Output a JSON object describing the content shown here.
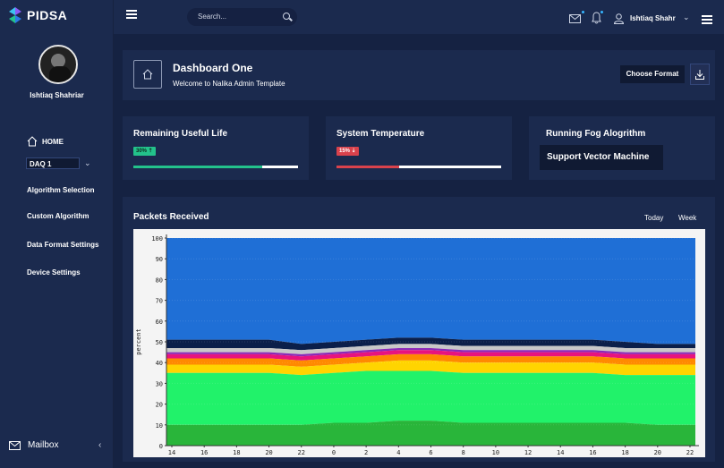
{
  "brand": {
    "name": "PIDSA"
  },
  "sidebar": {
    "username": "Ishtiaq Shahriar",
    "home_label": "HOME",
    "daq_selected": "DAQ 1",
    "items": [
      {
        "label": "Algorithm Selection"
      },
      {
        "label": "Custom Algorithm"
      },
      {
        "label": "Data Format Settings"
      },
      {
        "label": "Device Settings"
      }
    ],
    "mailbox_label": "Mailbox"
  },
  "header": {
    "search_placeholder": "Search...",
    "profile_name": "Ishtiaq Shahr"
  },
  "dashboard": {
    "title": "Dashboard One",
    "subtitle": "Welcome to Nalika Admin Template",
    "choose_format_label": "Choose Format"
  },
  "stats": [
    {
      "title": "Remaining Useful Life",
      "badge": "30% ⇡",
      "progress": 0.78,
      "color": "#23c28b"
    },
    {
      "title": "System Temperature",
      "badge": "15% ⇣",
      "progress": 0.38,
      "color": "#d9424c"
    }
  ],
  "fog": {
    "title": "Running Fog Alogrithm",
    "algorithm": "Support Vector Machine"
  },
  "packets": {
    "title": "Packets Received",
    "tabs": [
      {
        "label": "Today"
      },
      {
        "label": "Week"
      }
    ]
  },
  "chart_data": {
    "type": "area",
    "ylabel": "percent",
    "ylim": [
      0,
      100
    ],
    "yticks": [
      "0",
      "10",
      "20",
      "30",
      "40",
      "50",
      "60",
      "70",
      "80",
      "90",
      "100"
    ],
    "categories": [
      "14",
      "16",
      "18",
      "20",
      "22",
      "0",
      "2",
      "4",
      "6",
      "8",
      "10",
      "12",
      "14",
      "16",
      "18",
      "20",
      "22"
    ],
    "series": [
      {
        "color": "#29b53a",
        "values": [
          10,
          10,
          10,
          10,
          10,
          11,
          11,
          12,
          12,
          11,
          11,
          11,
          11,
          11,
          11,
          10,
          10
        ]
      },
      {
        "color": "#21f26a",
        "values": [
          35,
          35,
          35,
          35,
          34,
          35,
          36,
          36,
          36,
          35,
          35,
          35,
          35,
          35,
          34,
          34,
          34
        ]
      },
      {
        "color": "#ffd400",
        "values": [
          39,
          39,
          39,
          39,
          38,
          39,
          40,
          41,
          41,
          40,
          40,
          40,
          40,
          40,
          39,
          39,
          39
        ]
      },
      {
        "color": "#ff8a00",
        "values": [
          42,
          42,
          42,
          42,
          41,
          42,
          43,
          44,
          44,
          43,
          43,
          43,
          43,
          43,
          42,
          42,
          42
        ]
      },
      {
        "color": "#e8137e",
        "values": [
          44,
          44,
          44,
          44,
          43,
          44,
          45,
          46,
          46,
          45,
          45,
          45,
          45,
          45,
          44,
          44,
          44
        ]
      },
      {
        "color": "#8b2ab8",
        "values": [
          45,
          45,
          45,
          45,
          44,
          45,
          46,
          47,
          47,
          46,
          46,
          46,
          46,
          46,
          45,
          45,
          45
        ]
      },
      {
        "color": "#c8c8c8",
        "values": [
          47,
          47,
          47,
          47,
          46,
          47,
          48,
          49,
          49,
          48,
          48,
          48,
          48,
          48,
          47,
          47,
          47
        ]
      },
      {
        "color": "#0b1f4a",
        "values": [
          51,
          51,
          51,
          51,
          49,
          50,
          51,
          52,
          52,
          51,
          51,
          51,
          51,
          51,
          50,
          49,
          49
        ]
      },
      {
        "color": "#1f6fd6",
        "values": [
          100,
          100,
          100,
          100,
          100,
          100,
          100,
          100,
          100,
          100,
          100,
          100,
          100,
          100,
          100,
          100,
          100
        ]
      }
    ],
    "grid": true
  }
}
